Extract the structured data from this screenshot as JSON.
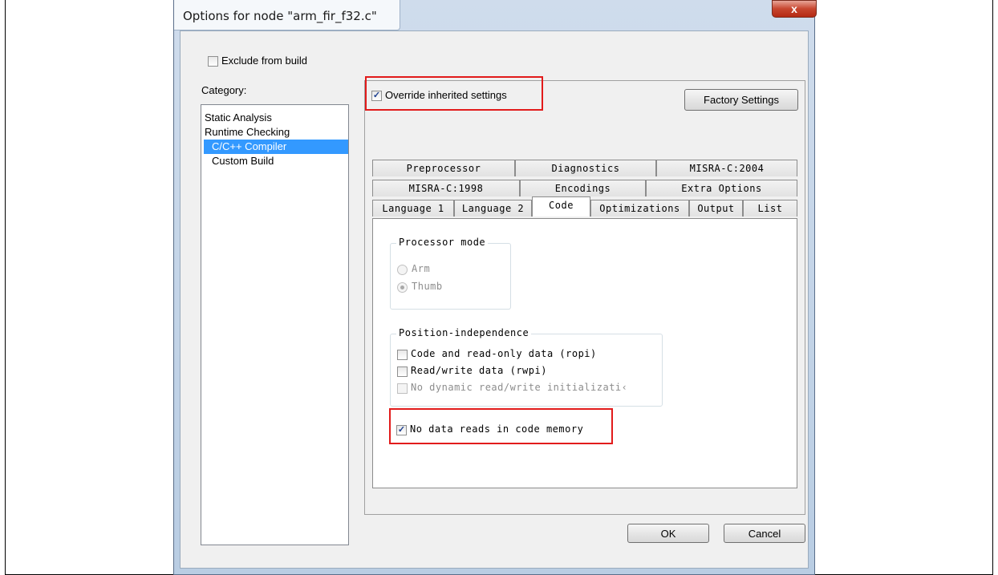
{
  "window": {
    "title": "Options for node \"arm_fir_f32.c\"",
    "close_label": "x"
  },
  "exclude_from_build": {
    "label": "Exclude from build",
    "checked": false
  },
  "category": {
    "label": "Category:",
    "items": [
      {
        "label": "Static Analysis"
      },
      {
        "label": "Runtime Checking"
      },
      {
        "label": "C/C++ Compiler",
        "selected": true
      },
      {
        "label": "Custom Build"
      }
    ]
  },
  "override": {
    "label": "Override inherited settings",
    "checked": true
  },
  "factory_settings_label": "Factory Settings",
  "tabs": {
    "row1": [
      "Preprocessor",
      "Diagnostics",
      "MISRA-C:2004"
    ],
    "row2": [
      "MISRA-C:1998",
      "Encodings",
      "Extra Options"
    ],
    "row3": [
      "Language 1",
      "Language 2",
      "Code",
      "Optimizations",
      "Output",
      "List"
    ],
    "active": "Code"
  },
  "processor_mode": {
    "title": "Processor mode",
    "options": [
      {
        "label": "Arm",
        "checked": false
      },
      {
        "label": "Thumb",
        "checked": true
      }
    ]
  },
  "position_independence": {
    "title": "Position-independence",
    "options": [
      {
        "label": "Code and read-only data (ropi)",
        "checked": false
      },
      {
        "label": "Read/write data (rwpi)",
        "checked": false
      },
      {
        "label": "No dynamic read/write initializati‹",
        "checked": false,
        "disabled": true
      }
    ]
  },
  "no_data_reads": {
    "label": "No data reads in code memory",
    "checked": true
  },
  "ok_label": "OK",
  "cancel_label": "Cancel",
  "colors": {
    "highlight": "#e21b1b",
    "selection": "#3399ff"
  }
}
